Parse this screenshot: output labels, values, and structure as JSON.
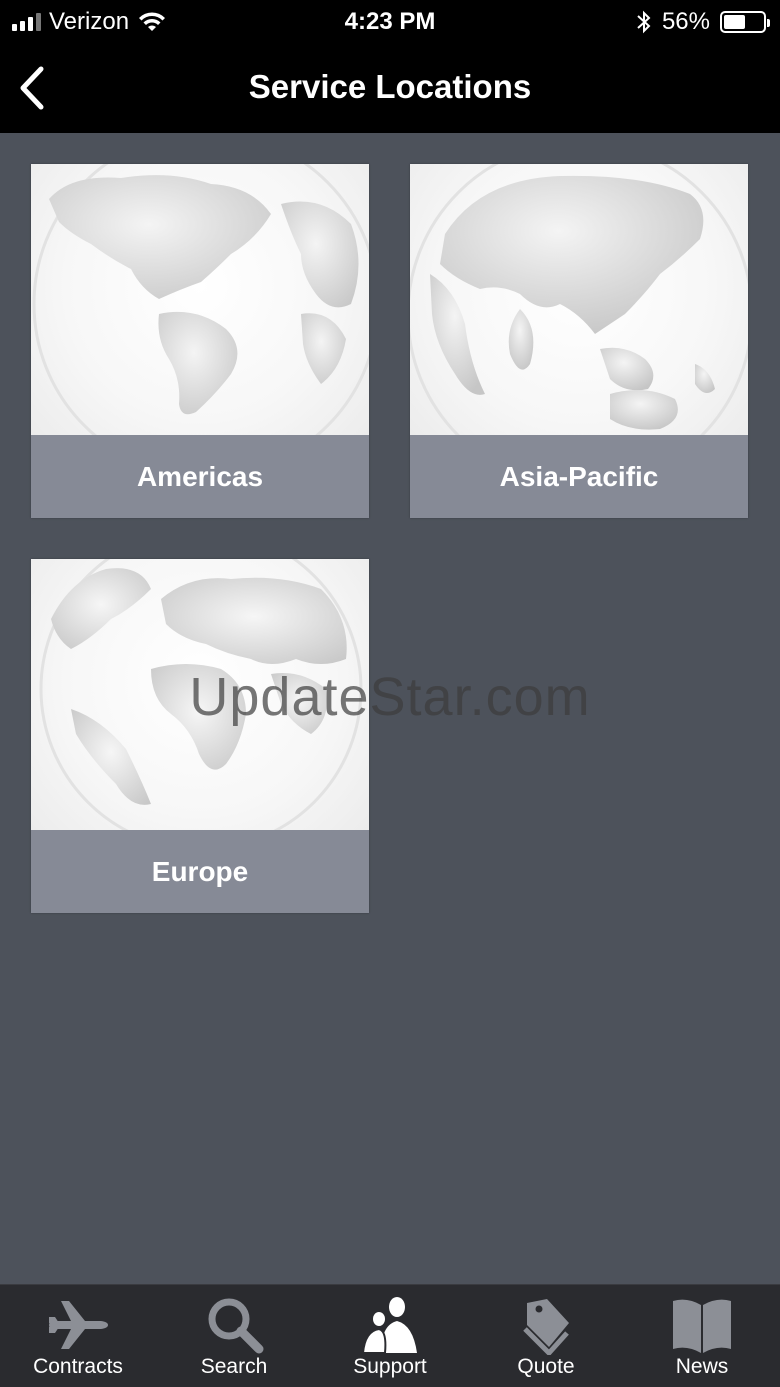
{
  "status_bar": {
    "carrier": "Verizon",
    "time": "4:23 PM",
    "battery": "56%",
    "battery_level": 0.56
  },
  "nav": {
    "title": "Service Locations",
    "back_icon": "chevron-left-icon"
  },
  "regions": [
    {
      "label": "Americas",
      "icon": "globe-americas-icon"
    },
    {
      "label": "Asia-Pacific",
      "icon": "globe-asia-icon"
    },
    {
      "label": "Europe",
      "icon": "globe-europe-icon"
    }
  ],
  "watermark": "UpdateStar.com",
  "tabs": [
    {
      "label": "Contracts",
      "icon": "airplane-icon"
    },
    {
      "label": "Search",
      "icon": "magnifier-icon"
    },
    {
      "label": "Support",
      "icon": "people-icon",
      "active": true
    },
    {
      "label": "Quote",
      "icon": "tags-icon"
    },
    {
      "label": "News",
      "icon": "book-icon"
    }
  ],
  "colors": {
    "background": "#4d525b",
    "bar": "#000000",
    "tile_label": "#868a96",
    "tabbar": "#2a2b2f",
    "icon_inactive": "#8c8f96",
    "icon_active": "#ffffff"
  }
}
